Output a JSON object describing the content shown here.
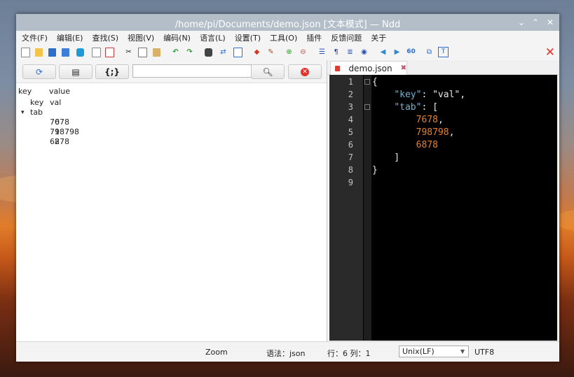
{
  "window": {
    "title": "/home/pi/Documents/demo.json [文本模式] — Ndd"
  },
  "titlebar_buttons": {
    "menu": "⌄",
    "maximize": "⌃",
    "close": "✕"
  },
  "menu": [
    "文件(F)",
    "编辑(E)",
    "查找(S)",
    "视图(V)",
    "编码(N)",
    "语言(L)",
    "设置(T)",
    "工具(O)",
    "插件",
    "反馈问题",
    "关于"
  ],
  "toolbar_icons": [
    "new-file-icon",
    "open-file-icon",
    "save-icon",
    "save-all-icon",
    "clone-icon",
    "close-file-icon",
    "close-all-icon",
    "cut-icon",
    "copy-icon",
    "paste-icon",
    "undo-icon",
    "redo-icon",
    "find-icon",
    "replace-icon",
    "bookmark-icon",
    "mark-icon",
    "clear-mark-icon",
    "zoom-in-icon",
    "zoom-out-icon",
    "word-wrap-icon",
    "show-symbols-icon",
    "indent-guide-icon",
    "record-macro-icon",
    "prev-icon",
    "next-icon",
    "goto-icon",
    "split-icon",
    "text-mode-icon"
  ],
  "left_panel": {
    "search_value": "",
    "tree_header": {
      "key": "key",
      "value": "value"
    },
    "tree_rows": [
      {
        "key": "key",
        "value": "val",
        "indent": 1,
        "arrow": ""
      },
      {
        "key": "tab",
        "value": "",
        "indent": 1,
        "arrow": "▾"
      },
      {
        "key": "0",
        "value": "7678",
        "indent": 2,
        "arrow": ""
      },
      {
        "key": "1",
        "value": "798798",
        "indent": 2,
        "arrow": ""
      },
      {
        "key": "2",
        "value": "6878",
        "indent": 2,
        "arrow": ""
      }
    ]
  },
  "editor": {
    "tab_label": "demo.json",
    "tab_close": "✖",
    "line_numbers": [
      "1",
      "2",
      "3",
      "4",
      "5",
      "6",
      "7",
      "8",
      "9"
    ],
    "lines": [
      [
        {
          "t": "{",
          "c": "#e8e8e8"
        }
      ],
      [
        {
          "t": "    ",
          "c": "#e8e8e8"
        },
        {
          "t": "\"key\"",
          "c": "#6fb3d2"
        },
        {
          "t": ": ",
          "c": "#e8e8e8"
        },
        {
          "t": "\"val\"",
          "c": "#e8e8e8"
        },
        {
          "t": ",",
          "c": "#e8e8e8"
        }
      ],
      [
        {
          "t": "    ",
          "c": "#e8e8e8"
        },
        {
          "t": "\"tab\"",
          "c": "#6fb3d2"
        },
        {
          "t": ": [",
          "c": "#e8e8e8"
        }
      ],
      [
        {
          "t": "        ",
          "c": "#e8e8e8"
        },
        {
          "t": "7678",
          "c": "#e8822e"
        },
        {
          "t": ",",
          "c": "#e8e8e8"
        }
      ],
      [
        {
          "t": "        ",
          "c": "#e8e8e8"
        },
        {
          "t": "798798",
          "c": "#e8822e"
        },
        {
          "t": ",",
          "c": "#e8e8e8"
        }
      ],
      [
        {
          "t": "        ",
          "c": "#e8e8e8"
        },
        {
          "t": "6878",
          "c": "#e8822e"
        }
      ],
      [
        {
          "t": "    ]",
          "c": "#e8e8e8"
        }
      ],
      [
        {
          "t": "}",
          "c": "#e8e8e8"
        }
      ],
      []
    ]
  },
  "status": {
    "zoom_label": "Zoom",
    "syntax": "语法：json",
    "position": "行：6 列：1",
    "eol": "Unix(LF)",
    "encoding": "UTF8"
  },
  "colors": {
    "key_color": "#6fb3d2",
    "number_color": "#e8822e",
    "editor_bg": "#000000",
    "titlebar_bg": "#b3bec9"
  }
}
